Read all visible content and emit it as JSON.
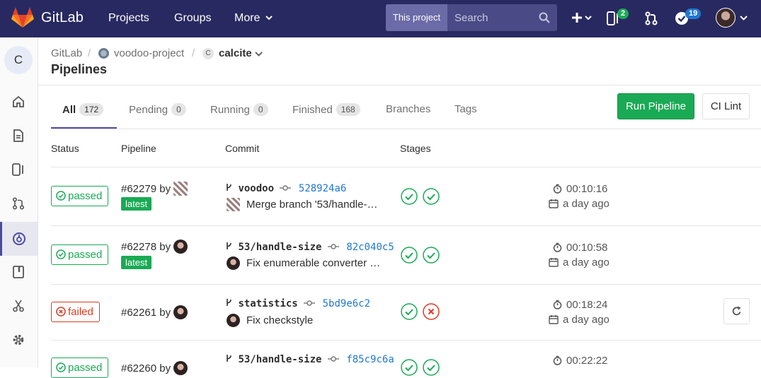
{
  "navbar": {
    "brand": "GitLab",
    "links": [
      "Projects",
      "Groups",
      "More"
    ],
    "search": {
      "scope": "This project",
      "placeholder": "Search"
    },
    "badges": {
      "issues": "2",
      "todos": "19"
    }
  },
  "sidebar": {
    "project_initial": "C",
    "items": [
      "home-icon",
      "repository-icon",
      "issues-icon",
      "merge-requests-icon",
      "ci-cd-icon",
      "wiki-icon",
      "snippets-icon",
      "settings-icon"
    ],
    "active_item": "ci-cd-icon"
  },
  "breadcrumb": {
    "root": "GitLab",
    "group": "voodoo-project",
    "project_initial": "C",
    "project": "calcite"
  },
  "page_title": "Pipelines",
  "tabs": [
    {
      "label": "All",
      "count": "172"
    },
    {
      "label": "Pending",
      "count": "0"
    },
    {
      "label": "Running",
      "count": "0"
    },
    {
      "label": "Finished",
      "count": "168"
    },
    {
      "label": "Branches"
    },
    {
      "label": "Tags"
    }
  ],
  "buttons": {
    "run_pipeline": "Run Pipeline",
    "ci_lint": "CI Lint"
  },
  "table": {
    "headers": [
      "Status",
      "Pipeline",
      "Commit",
      "Stages"
    ],
    "rows": [
      {
        "status": "passed",
        "pipeline": "#62279",
        "by": "by",
        "latest": "latest",
        "branch": "voodoo",
        "sha": "528924a6",
        "message": "Merge branch '53/handle-…",
        "stages": [
          "passed",
          "passed"
        ],
        "duration": "00:10:16",
        "finished": "a day ago"
      },
      {
        "status": "passed",
        "pipeline": "#62278",
        "by": "by",
        "latest": "latest",
        "branch": "53/handle-size",
        "sha": "82c040c5",
        "message": "Fix enumerable converter …",
        "stages": [
          "passed",
          "passed"
        ],
        "duration": "00:10:58",
        "finished": "a day ago"
      },
      {
        "status": "failed",
        "pipeline": "#62261",
        "by": "by",
        "branch": "statistics",
        "sha": "5bd9e6c2",
        "message": "Fix checkstyle",
        "stages": [
          "passed",
          "failed"
        ],
        "duration": "00:18:24",
        "finished": "a day ago"
      },
      {
        "status": "passed",
        "pipeline": "#62260",
        "by": "by",
        "branch": "53/handle-size",
        "sha": "f85c9c6a",
        "stages": [
          "passed",
          "passed"
        ],
        "duration": "00:22:22"
      }
    ]
  },
  "colors": {
    "navbar": "#292961",
    "success": "#1aaa55",
    "danger": "#db3b21",
    "link": "#1f78d1",
    "accent": "#4b4ba3"
  }
}
